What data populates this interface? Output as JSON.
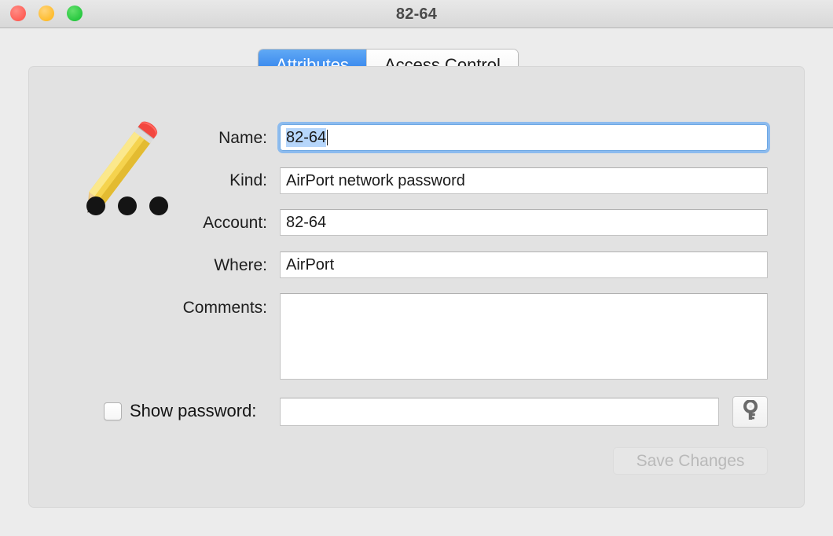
{
  "window": {
    "title": "82-64",
    "controls": [
      {
        "name": "close",
        "icon": "close-traffic-light",
        "color": "#ff5f57"
      },
      {
        "name": "minimize",
        "icon": "minimize-traffic-light",
        "color": "#febc2e"
      },
      {
        "name": "maximize",
        "icon": "maximize-traffic-light",
        "color": "#28c840"
      }
    ]
  },
  "tabs": [
    {
      "label": "Attributes",
      "selected": true
    },
    {
      "label": "Access Control",
      "selected": false
    }
  ],
  "item_icon": {
    "icon": "pencil-icon",
    "dots": 3,
    "dot_color": "#141414"
  },
  "form": {
    "name": {
      "label": "Name:",
      "value": "82-64",
      "focused": true,
      "selected": true
    },
    "kind": {
      "label": "Kind:",
      "value": "AirPort network password"
    },
    "account": {
      "label": "Account:",
      "value": "82-64"
    },
    "where": {
      "label": "Where:",
      "value": "AirPort"
    },
    "comments": {
      "label": "Comments:",
      "value": ""
    }
  },
  "password_row": {
    "checkbox_label": "Show password:",
    "checked": false,
    "password_value": "",
    "key_button_icon": "key-icon"
  },
  "actions": {
    "save_label": "Save Changes",
    "save_enabled": false
  },
  "colors": {
    "accent": "#1d72e8",
    "selection": "#b6d6fb",
    "focus_ring": "#8cbbee",
    "window_background": "#ececec",
    "panel_background": "#e2e2e2",
    "disabled_text": "#b9b9b9"
  }
}
